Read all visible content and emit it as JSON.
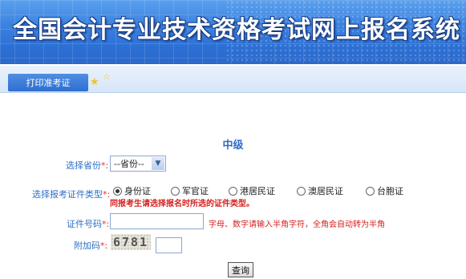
{
  "banner": {
    "title": "全国会计专业技术资格考试网上报名系统"
  },
  "nav": {
    "print_tab_label": "打印准考证"
  },
  "form": {
    "level_title": "中级",
    "province": {
      "label": "选择省份",
      "required_mark": "*:",
      "selected": "--省份--"
    },
    "id_type": {
      "label": "选择报考证件类型",
      "required_mark": "*:",
      "options": [
        "身份证",
        "军官证",
        "港居民证",
        "澳居民证",
        "台胞证"
      ],
      "selected_index": 0,
      "note": "同报考生请选择报名时所选的证件类型。"
    },
    "id_number": {
      "label": "证件号码",
      "required_mark": "*:",
      "value": "",
      "hint": "字母、数字请输入半角字符，全角会自动转为半角"
    },
    "captcha": {
      "label": "附加码",
      "required_mark": "*:",
      "code": "6781",
      "value": ""
    },
    "query_button_label": "查询"
  },
  "colors": {
    "banner_blue": "#3b82e0",
    "label_blue": "#2e6fc6",
    "alert_red": "#d81e1e"
  }
}
